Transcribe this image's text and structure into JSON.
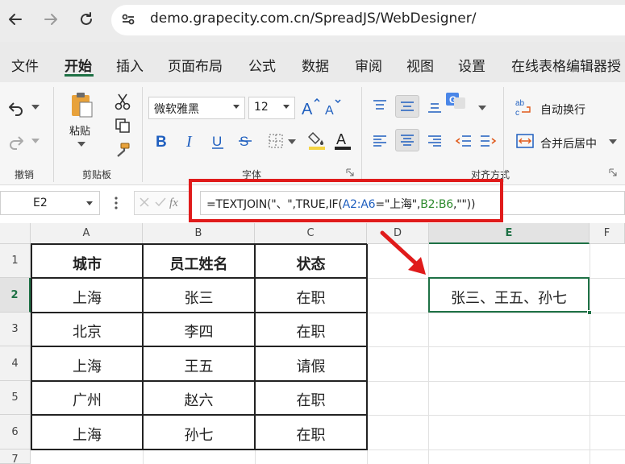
{
  "browser": {
    "url": "demo.grapecity.com.cn/SpreadJS/WebDesigner/"
  },
  "ribbon": {
    "tabs": [
      "文件",
      "开始",
      "插入",
      "页面布局",
      "公式",
      "数据",
      "审阅",
      "视图",
      "设置",
      "在线表格编辑器授"
    ],
    "active_tab": "开始",
    "groups": {
      "undo_label": "撤销",
      "clipboard_label": "剪贴板",
      "paste_label": "粘贴",
      "font_label": "字体",
      "align_label": "对齐方式"
    },
    "font_name": "微软雅黑",
    "font_size": "12",
    "wrap_text": "自动换行",
    "merge_center": "合并后居中"
  },
  "formula_bar": {
    "name_box": "E2",
    "fx_label": "fx",
    "formula_prefix": "=TEXTJOIN(\"、\",TRUE,IF(",
    "formula_ref_a": "A2:A6",
    "formula_mid": "=\"上海\",",
    "formula_ref_b": "B2:B6",
    "formula_suffix": ",\"\"))"
  },
  "grid": {
    "columns": [
      "A",
      "B",
      "C",
      "D",
      "E",
      "F"
    ],
    "rows": [
      "1",
      "2",
      "3",
      "4",
      "5",
      "6",
      "7"
    ],
    "active_column": "E",
    "active_row": "2",
    "table": {
      "headers": [
        "城市",
        "员工姓名",
        "状态"
      ],
      "rows": [
        [
          "上海",
          "张三",
          "在职"
        ],
        [
          "北京",
          "李四",
          "在职"
        ],
        [
          "上海",
          "王五",
          "请假"
        ],
        [
          "广州",
          "赵六",
          "在职"
        ],
        [
          "上海",
          "孙七",
          "在职"
        ]
      ]
    },
    "result_cell": "张三、王五、孙七"
  },
  "colors": {
    "accent": "#1e7145",
    "highlight": "#e01b1b",
    "ref_a": "#1f5fbf",
    "ref_b": "#2e8b2e"
  }
}
